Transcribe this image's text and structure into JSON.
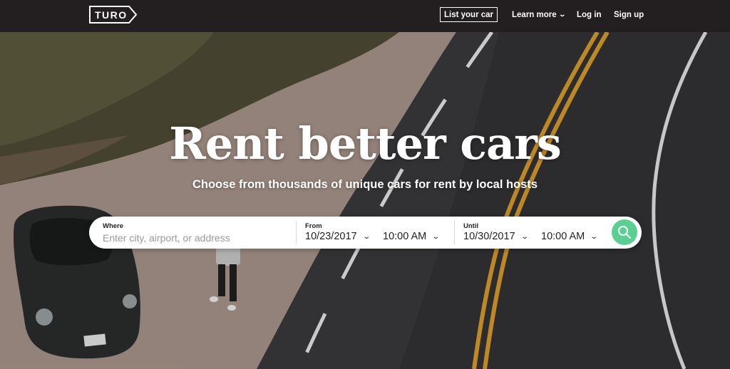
{
  "nav": {
    "logo_text": "TURO",
    "list_car_label": "List your car",
    "learn_more_label": "Learn more",
    "login_label": "Log in",
    "signup_label": "Sign up",
    "chevron_icon": "chevron-down-icon"
  },
  "hero": {
    "headline": "Rent better cars",
    "subheadline": "Choose from thousands of unique cars for rent by local hosts"
  },
  "search": {
    "where_label": "Where",
    "where_placeholder": "Enter city, airport, or address",
    "from_label": "From",
    "from_date": "10/23/2017",
    "from_time": "10:00 AM",
    "until_label": "Until",
    "until_date": "10/30/2017",
    "until_time": "10:00 AM",
    "search_icon": "search-icon",
    "search_button_color": "#59d092"
  },
  "colors": {
    "nav_bg": "#231f20",
    "accent": "#59d092"
  }
}
